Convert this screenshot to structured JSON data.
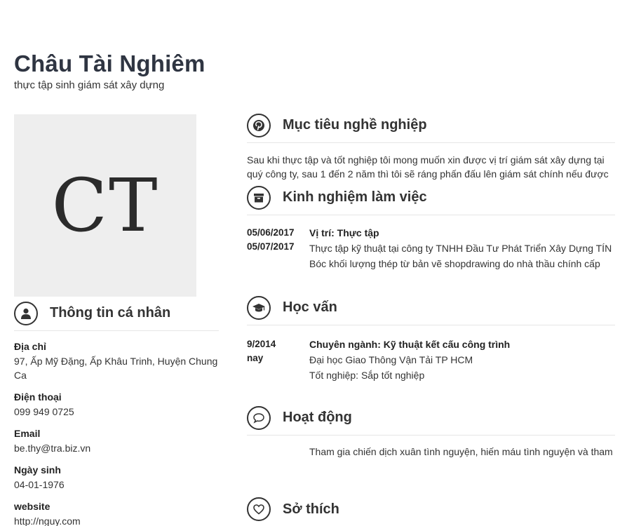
{
  "header": {
    "name": "Châu Tài Nghiêm",
    "job_title": "thực tập sinh giám sát xây dựng"
  },
  "avatar": {
    "initials": "CT"
  },
  "personal_info": {
    "title": "Thông tin cá nhân",
    "icon": "user-icon",
    "items": [
      {
        "label": "Địa chỉ",
        "value": "97, Ấp Mỹ Đặng, Ấp Khâu Trinh, Huyện Chung Ca"
      },
      {
        "label": "Điện thoại",
        "value": "099 949 0725"
      },
      {
        "label": "Email",
        "value": "be.thy@tra.biz.vn"
      },
      {
        "label": "Ngày sinh",
        "value": "04-01-1976"
      },
      {
        "label": "website",
        "value": "http://nguy.com"
      }
    ]
  },
  "objective": {
    "title": "Mục tiêu nghề nghiệp",
    "icon": "pinterest-icon",
    "lines": [
      "Sau khi thực tập và tốt nghiệp tôi mong muốn xin được vị trí giám sát xây dựng tại",
      "quý công ty, sau 1 đến 2 năm thì tôi sẽ ráng phấn đấu lên giám sát chính nếu được"
    ]
  },
  "experience": {
    "title": "Kinh nghiệm làm việc",
    "icon": "archive-icon",
    "entries": [
      {
        "start": "05/06/2017",
        "end": "05/07/2017",
        "position": "Vị trí: Thực tập",
        "lines": [
          "Thực tập kỹ thuật tại công ty TNHH Đầu Tư Phát Triển Xây Dựng TÍN",
          "Bóc khối lượng thép từ bản vẽ shopdrawing do nhà thầu chính cấp"
        ]
      }
    ]
  },
  "education": {
    "title": "Học vấn",
    "icon": "graduation-cap-icon",
    "entries": [
      {
        "start": "9/2014",
        "end": "nay",
        "major": "Chuyên ngành: Kỹ thuật kết cấu công trình",
        "lines": [
          "Đại học Giao Thông Vận Tải TP HCM",
          "Tốt nghiệp: Sắp tốt nghiệp"
        ]
      }
    ]
  },
  "activities": {
    "title": "Hoạt động",
    "icon": "speech-bubble-icon",
    "line": "Tham gia chiến dịch xuân tình nguyện, hiến máu tình nguyện và tham"
  },
  "hobbies": {
    "title": "Sở thích",
    "icon": "heart-icon"
  },
  "colors": {
    "name": "#2f3542",
    "text": "#333333",
    "avatar_bg": "#eeeeee",
    "divider": "#e6e6e6"
  }
}
